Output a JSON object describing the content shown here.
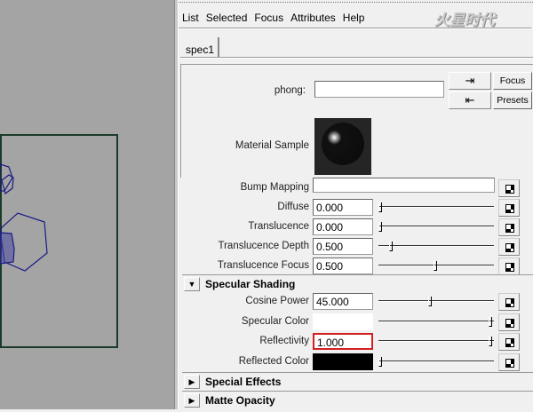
{
  "menu": [
    "List",
    "Selected",
    "Focus",
    "Attributes",
    "Help"
  ],
  "watermark": "火星时代",
  "tab": "spec1",
  "header": {
    "node_label": "phong:",
    "node_value": "",
    "focus_button": "Focus",
    "presets_button": "Presets",
    "material_sample_label": "Material Sample"
  },
  "rows": [
    {
      "label": "Bump Mapping",
      "value": "",
      "type": "map"
    },
    {
      "label": "Diffuse",
      "value": "0.000",
      "slider": 0.0
    },
    {
      "label": "Translucence",
      "value": "0.000",
      "slider": 0.0
    },
    {
      "label": "Translucence Depth",
      "value": "0.500",
      "slider": 0.1
    },
    {
      "label": "Translucence Focus",
      "value": "0.500",
      "slider": 0.5
    }
  ],
  "specular_section": {
    "title": "Specular Shading",
    "expanded": true
  },
  "spec_rows": [
    {
      "label": "Cosine Power",
      "value": "45.000",
      "slider": 0.45
    },
    {
      "label": "Specular Color",
      "value": "",
      "swatch": "#ffffff",
      "slider": 1.0
    },
    {
      "label": "Reflectivity",
      "value": "1.000",
      "slider": 1.0,
      "highlighted": true,
      "highlight_color": "#d42020"
    },
    {
      "label": "Reflected Color",
      "value": "",
      "swatch": "#000000",
      "slider": 0.0
    }
  ],
  "collapsed_sections": [
    "Special Effects",
    "Matte Opacity"
  ]
}
